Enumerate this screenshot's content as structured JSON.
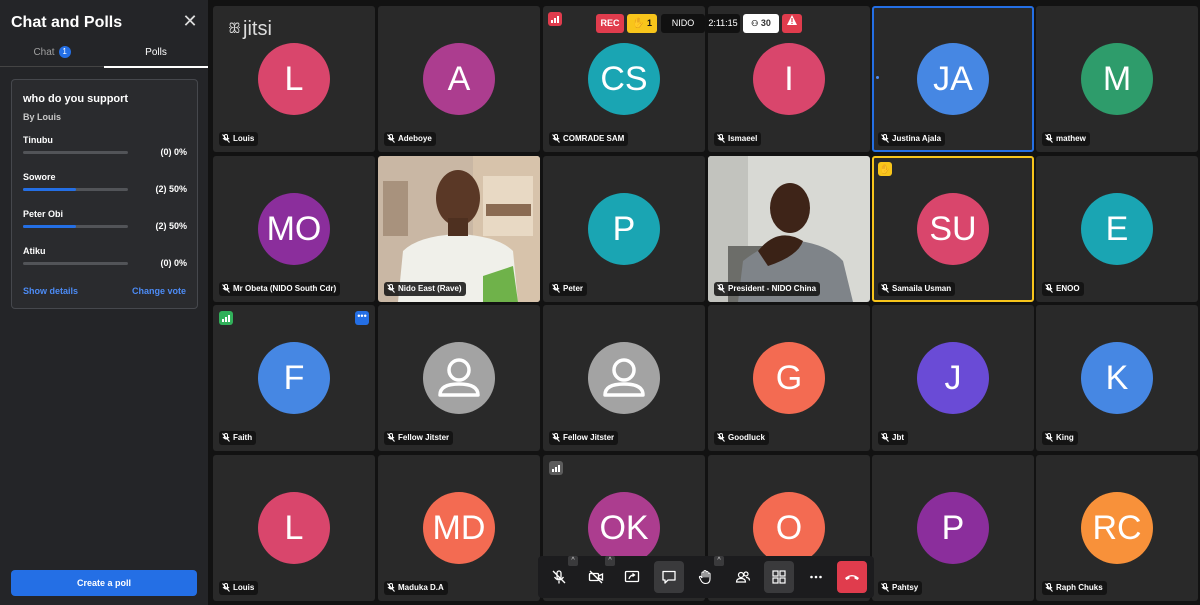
{
  "sidebar": {
    "title": "Chat and Polls",
    "close_glyph": "✕",
    "tabs": {
      "chat": "Chat",
      "chat_badge": "1",
      "polls": "Polls"
    },
    "poll": {
      "question": "who do you support",
      "by": "By Louis",
      "options": [
        {
          "name": "Tinubu",
          "count": "(0) 0%",
          "fraction": 0
        },
        {
          "name": "Sowore",
          "count": "(2) 50%",
          "fraction": 0.5
        },
        {
          "name": "Peter Obi",
          "count": "(2) 50%",
          "fraction": 0.5
        },
        {
          "name": "Atiku",
          "count": "(0) 0%",
          "fraction": 0
        }
      ],
      "show_details": "Show details",
      "change_vote": "Change vote"
    },
    "create_poll": "Create a poll"
  },
  "header": {
    "logo": "jitsi",
    "rec": "REC",
    "raised_hands": "1",
    "room": "NIDO",
    "timer": "2:11:15",
    "participants": "30"
  },
  "colors": {
    "accent": "#246fe5",
    "raise_hand": "#f8c51b",
    "rec": "#e03c4d",
    "hangup": "#e03c4d"
  },
  "participants": [
    {
      "initials": "L",
      "name": "Louis",
      "color": "#d9466c"
    },
    {
      "initials": "A",
      "name": "Adeboye",
      "color": "#ac3d8f"
    },
    {
      "initials": "CS",
      "name": "COMRADE SAM",
      "color": "#1aa5b3"
    },
    {
      "initials": "I",
      "name": "Ismaeel",
      "color": "#d9466c"
    },
    {
      "initials": "JA",
      "name": "Justina Ajala",
      "color": "#4687e3"
    },
    {
      "initials": "M",
      "name": "mathew",
      "color": "#2e9c6b"
    },
    {
      "initials": "MO",
      "name": "Mr Obeta (NIDO South Cdr)",
      "color": "#8b2e9c"
    },
    {
      "initials": "",
      "name": "Nido East (Rave)",
      "color": ""
    },
    {
      "initials": "P",
      "name": "Peter",
      "color": "#1aa5b3"
    },
    {
      "initials": "",
      "name": "President - NIDO China",
      "color": ""
    },
    {
      "initials": "SU",
      "name": "Samaila Usman",
      "color": "#d9466c"
    },
    {
      "initials": "E",
      "name": "ENOO",
      "color": "#1aa5b3"
    },
    {
      "initials": "F",
      "name": "Faith",
      "color": "#4687e3"
    },
    {
      "initials": "",
      "name": "Fellow Jitster",
      "color": "#a3a3a3"
    },
    {
      "initials": "",
      "name": "Fellow Jitster",
      "color": "#a3a3a3"
    },
    {
      "initials": "G",
      "name": "Goodluck",
      "color": "#f36b52"
    },
    {
      "initials": "J",
      "name": "Jbt",
      "color": "#6a4bd6"
    },
    {
      "initials": "K",
      "name": "King",
      "color": "#4687e3"
    },
    {
      "initials": "L",
      "name": "Louis",
      "color": "#d9466c"
    },
    {
      "initials": "MD",
      "name": "Maduka D.A",
      "color": "#f36b52"
    },
    {
      "initials": "OK",
      "name": "",
      "color": "#ac3d8f"
    },
    {
      "initials": "O",
      "name": "",
      "color": "#f36b52"
    },
    {
      "initials": "P",
      "name": "Pahtsy",
      "color": "#8b2e9c"
    },
    {
      "initials": "RC",
      "name": "Raph Chuks",
      "color": "#f8913a"
    }
  ],
  "toolbar": [
    {
      "icon": "mic-muted-icon"
    },
    {
      "icon": "camera-off-icon"
    },
    {
      "icon": "screen-share-icon"
    },
    {
      "icon": "chat-icon"
    },
    {
      "icon": "raise-hand-icon"
    },
    {
      "icon": "participants-icon"
    },
    {
      "icon": "tile-view-icon"
    },
    {
      "icon": "more-icon"
    },
    {
      "icon": "hangup-icon"
    }
  ]
}
